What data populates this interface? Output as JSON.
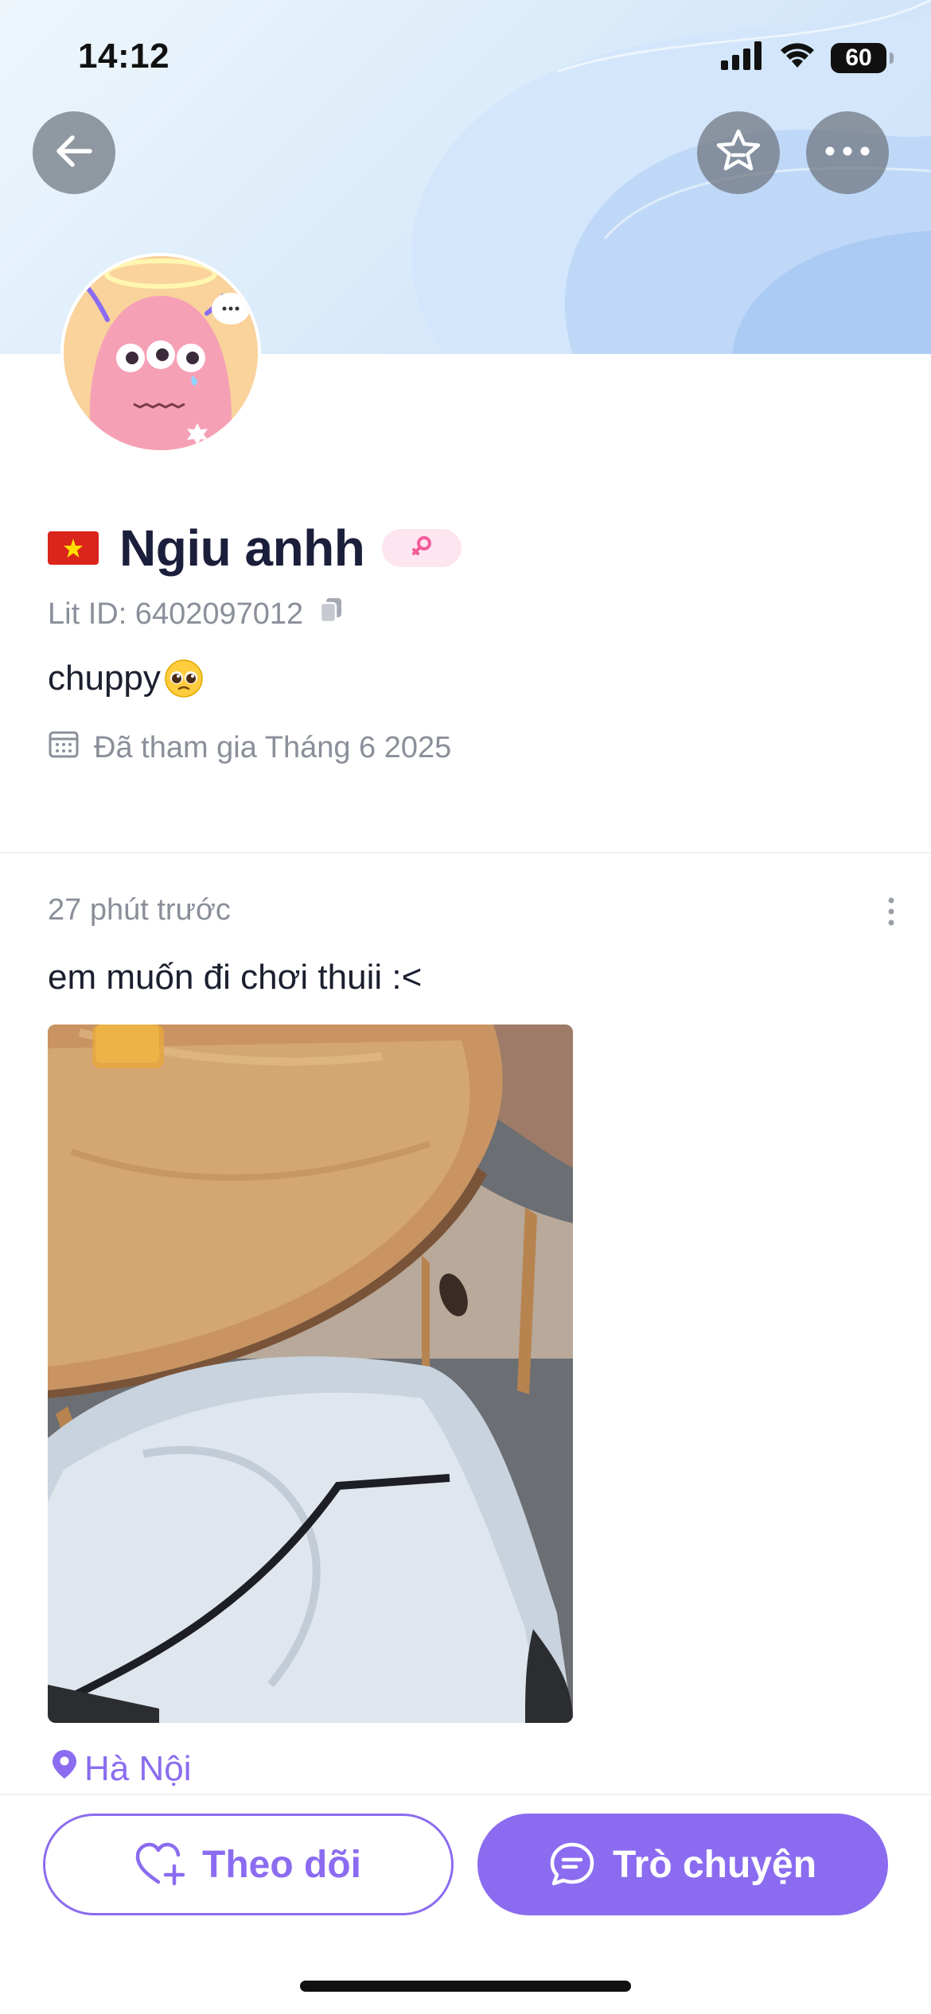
{
  "status_bar": {
    "time": "14:12",
    "battery": "60",
    "icons": [
      "signal-icon",
      "wifi-icon",
      "battery-icon"
    ]
  },
  "header": {
    "back_icon": "arrow-left-icon",
    "star_icon": "star-icon",
    "more_icon": "more-horizontal-icon"
  },
  "profile": {
    "flag_icon": "vietnam-flag-icon",
    "name": "Ngiu anhh",
    "gender_icon": "female-icon",
    "lit_id": "Lit ID: 6402097012",
    "copy_icon": "copy-icon",
    "bio": "chuppy",
    "bio_emoji": "pleading-face-emoji",
    "joined": "Đã tham gia Tháng 6 2025",
    "calendar_icon": "calendar-icon"
  },
  "post": {
    "time": "27 phút trước",
    "text": "em muốn đi chơi thuii :<",
    "location": "Hà Nội",
    "location_icon": "location-pin-icon"
  },
  "actions": {
    "follow_label": "Theo dõi",
    "chat_label": "Trò chuyện"
  },
  "colors": {
    "accent": "#8b6cf0",
    "text_primary": "#1b1f3b",
    "text_secondary": "#8a8f9a",
    "gender_badge_bg": "#fde6ef",
    "gender_badge_fg": "#f25c9b"
  }
}
